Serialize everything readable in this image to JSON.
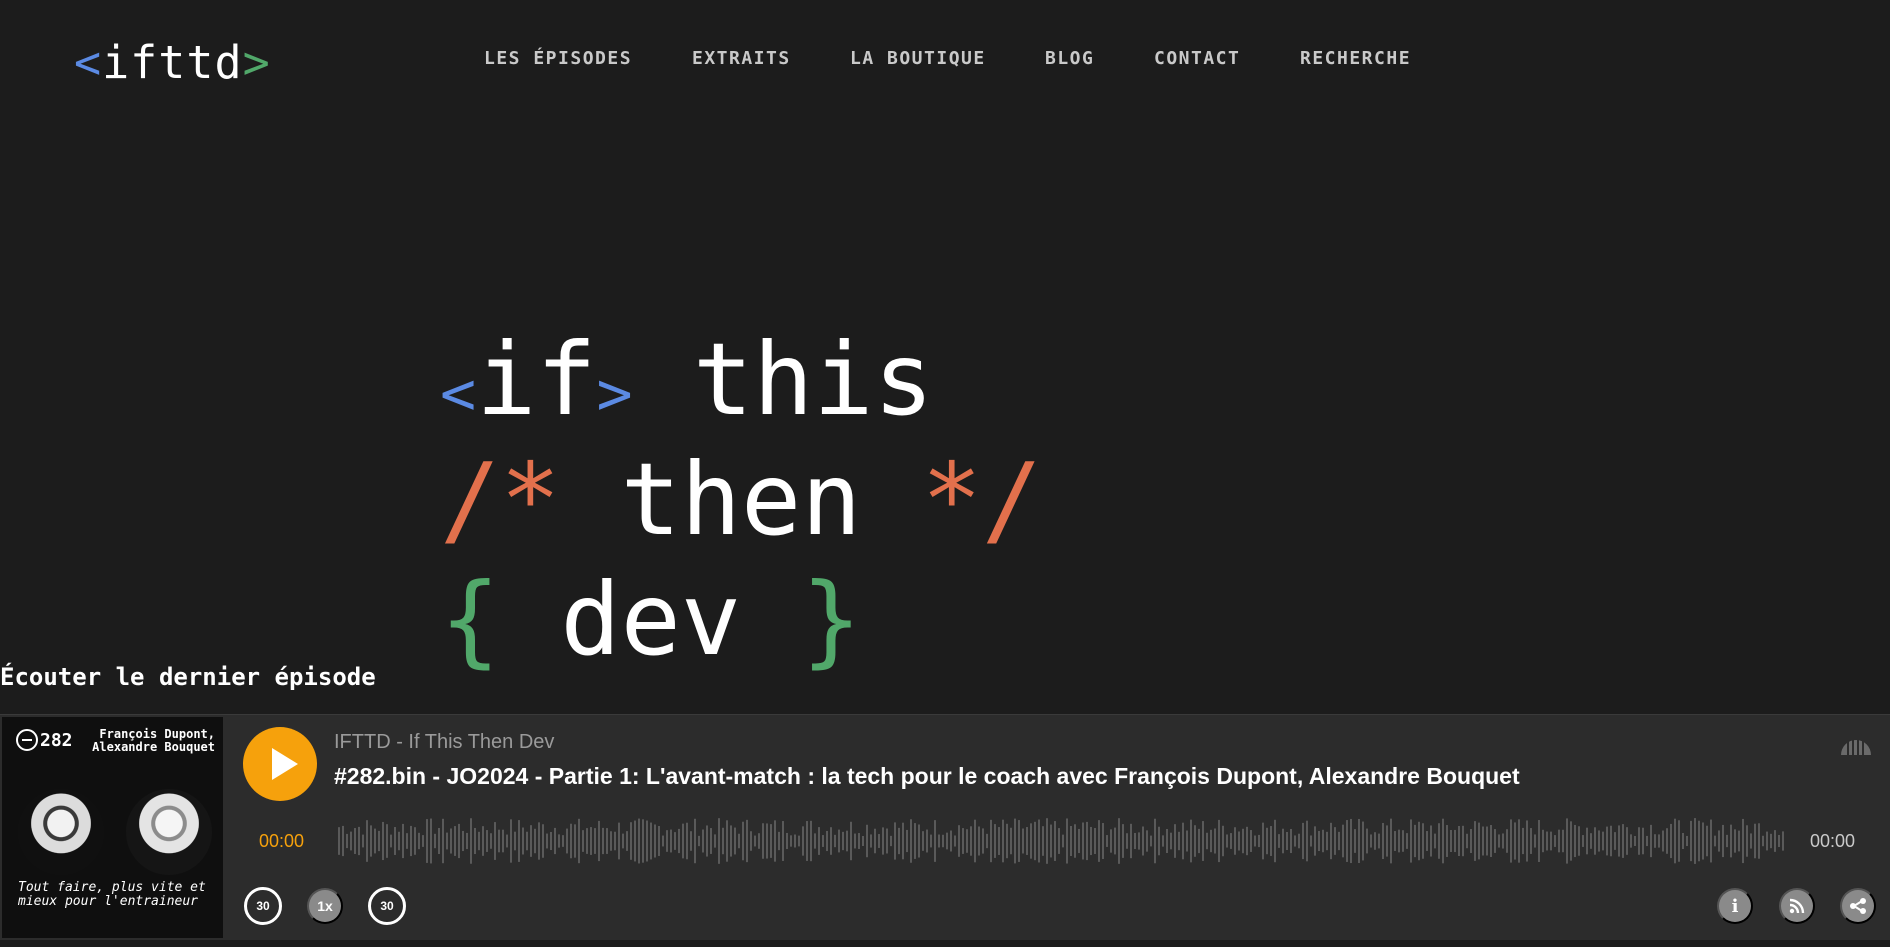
{
  "header": {
    "logo": {
      "lt": "<",
      "text": "ifttd",
      "gt": ">"
    },
    "nav": [
      {
        "label": "LES ÉPISODES"
      },
      {
        "label": "EXTRAITS"
      },
      {
        "label": "LA BOUTIQUE"
      },
      {
        "label": "BLOG"
      },
      {
        "label": "CONTACT"
      },
      {
        "label": "RECHERCHE"
      }
    ]
  },
  "hero": {
    "line1": {
      "open": "<",
      "if": "if",
      "close": ">",
      "rest": " this"
    },
    "line2": {
      "open": "/*",
      "mid": " then ",
      "close": "*/"
    },
    "line3": {
      "open": "{",
      "mid": " dev ",
      "close": "}"
    }
  },
  "listen_title": "Écouter le dernier épisode",
  "player": {
    "cover": {
      "episode_number": "282",
      "guests": "François Dupont, Alexandre Bouquet",
      "tagline": "Tout faire, plus vite et mieux pour l'entraineur"
    },
    "podcast_name": "IFTTD - If This Then Dev",
    "episode_title": "#282.bin - JO2024 - Partie 1: L'avant-match : la tech pour le coach avec François Dupont, Alexandre Bouquet",
    "current_time": "00:00",
    "duration": "00:00",
    "progress": 0,
    "controls": {
      "rewind_label": "30",
      "speed_label": "1x",
      "forward_label": "30",
      "info_label": "i"
    },
    "colors": {
      "accent": "#f6a10c",
      "waveform": "#5a5a5a"
    }
  },
  "icons": [
    "play-icon",
    "rewind-30-icon",
    "forward-30-icon",
    "info-icon",
    "rss-icon",
    "share-icon",
    "brand-icon",
    "episode-ring-icon"
  ]
}
